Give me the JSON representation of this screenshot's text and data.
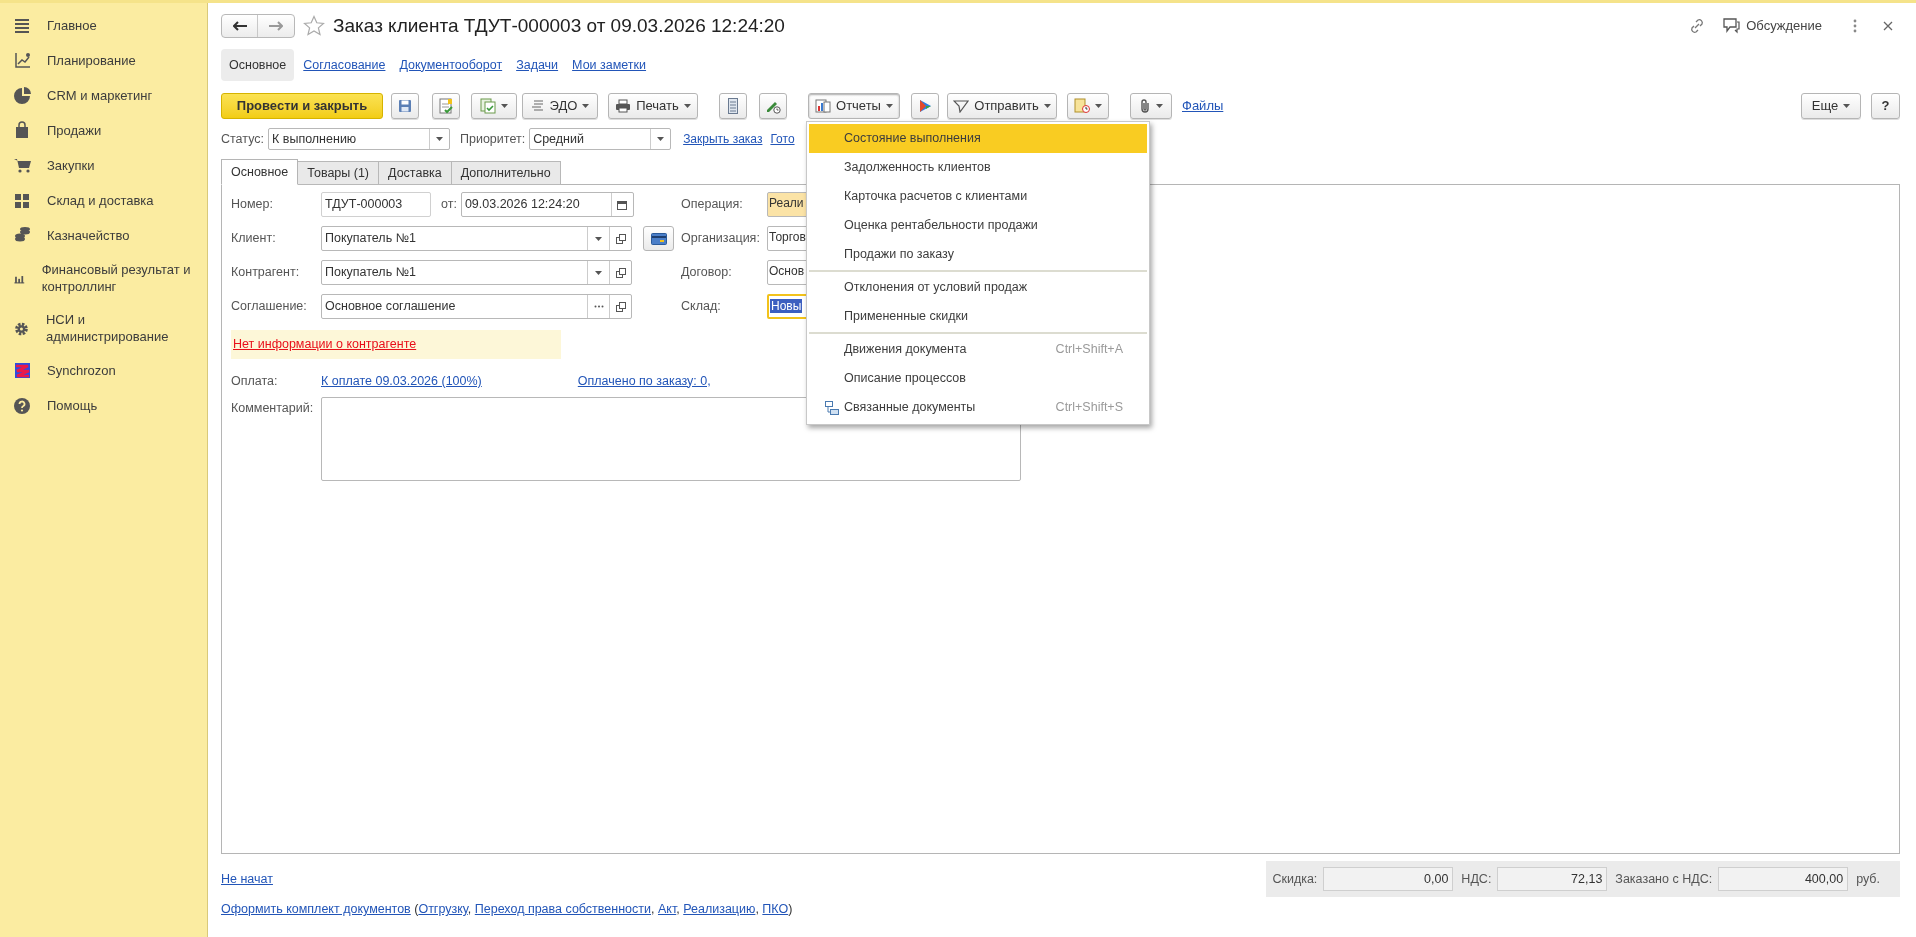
{
  "sidebar": [
    {
      "label": "Главное"
    },
    {
      "label": "Планирование"
    },
    {
      "label": "CRM и маркетинг"
    },
    {
      "label": "Продажи"
    },
    {
      "label": "Закупки"
    },
    {
      "label": "Склад и доставка"
    },
    {
      "label": "Казначейство"
    },
    {
      "label": "Финансовый результат и контроллинг"
    },
    {
      "label": "НСИ и администрирование"
    },
    {
      "label": "Synchrozon"
    },
    {
      "label": "Помощь"
    }
  ],
  "header": {
    "title": "Заказ клиента ТДУТ-000003 от 09.03.2026 12:24:20",
    "discussion": "Обсуждение"
  },
  "nav_tabs": [
    {
      "label": "Основное",
      "selected": true
    },
    {
      "label": "Согласование",
      "selected": false
    },
    {
      "label": "Документооборот",
      "selected": false
    },
    {
      "label": "Задачи",
      "selected": false
    },
    {
      "label": "Мои заметки",
      "selected": false
    }
  ],
  "toolbar": {
    "post": "Провести и закрыть",
    "edo": "ЭДО",
    "print": "Печать",
    "reports": {
      "label": "Отчеты",
      "expanded": true
    },
    "send": "Отправить",
    "files": "Файлы",
    "more": "Еще",
    "help": "?"
  },
  "status_row": {
    "status_label": "Статус:",
    "status": "К выполнению",
    "priority_label": "Приоритет:",
    "priority": "Средний",
    "links": [
      "Закрыть заказ",
      "Гото"
    ]
  },
  "form_tabs": [
    {
      "label": "Основное",
      "selected": true
    },
    {
      "label": "Товары (1)",
      "selected": false
    },
    {
      "label": "Доставка",
      "selected": false
    },
    {
      "label": "Дополнительно",
      "selected": false
    }
  ],
  "left_fields": [
    {
      "label": "Номер:",
      "value": "ТДУТ-000003",
      "kind": "number",
      "date_label": "от:",
      "date": "09.03.2026 12:24:20"
    },
    {
      "label": "Клиент:",
      "value": "Покупатель №1",
      "kind": "client"
    },
    {
      "label": "Контрагент:",
      "value": "Покупатель №1",
      "kind": "choice"
    },
    {
      "label": "Соглашение:",
      "value": "Основное соглашение",
      "kind": "select"
    }
  ],
  "right_fields": [
    {
      "label": "Операция:",
      "value": "Реали",
      "focused": false,
      "highlighted": true
    },
    {
      "label": "Организация:",
      "value": "Торгов",
      "focused": false,
      "highlighted": false
    },
    {
      "label": "Договор:",
      "value": "Основ",
      "focused": false,
      "highlighted": false
    },
    {
      "label": "Склад:",
      "value": "Новы",
      "focused": true,
      "highlighted": false
    }
  ],
  "warning": "Нет информации о контрагенте",
  "payment": {
    "label": "Оплата:",
    "link": "К оплате 09.03.2026 (100%)",
    "paid_link": "Оплачено по заказу: 0,"
  },
  "comment": {
    "label": "Комментарий:"
  },
  "menu": [
    {
      "label": "Состояние выполнения",
      "selected": true,
      "separator_before": false,
      "kind": "text"
    },
    {
      "label": "Задолженность клиентов",
      "selected": false,
      "separator_before": false,
      "kind": "text"
    },
    {
      "label": "Карточка расчетов с клиентами",
      "selected": false,
      "separator_before": false,
      "kind": "text"
    },
    {
      "label": "Оценка рентабельности продажи",
      "selected": false,
      "separator_before": false,
      "kind": "text"
    },
    {
      "label": "Продажи по заказу",
      "selected": false,
      "separator_before": false,
      "kind": "text"
    },
    {
      "label": "Отклонения от условий продаж",
      "selected": false,
      "separator_before": true,
      "kind": "text"
    },
    {
      "label": "Примененные скидки",
      "selected": false,
      "separator_before": false,
      "kind": "text"
    },
    {
      "label": "Движения документа",
      "selected": false,
      "separator_before": true,
      "kind": "text",
      "shortcut": "Ctrl+Shift+A"
    },
    {
      "label": "Описание процессов",
      "selected": false,
      "separator_before": false,
      "kind": "text"
    },
    {
      "label": "Связанные документы",
      "selected": false,
      "separator_before": false,
      "kind": "icon",
      "shortcut": "Ctrl+Shift+S"
    }
  ],
  "footer": {
    "state_link": "Не начат",
    "totals": [
      {
        "label": "Скидка:",
        "value": "0,00"
      },
      {
        "label": "НДС:",
        "value": "72,13"
      },
      {
        "label": "Заказано с НДС:",
        "value": "400,00"
      }
    ],
    "currency": "руб.",
    "docs": {
      "main": "Оформить комплект документов",
      "open": " (",
      "links": [
        "Отгрузку",
        "Переход права собственности",
        "Акт",
        "Реализацию",
        "ПКО"
      ],
      "separator": ", ",
      "close": ")"
    }
  }
}
